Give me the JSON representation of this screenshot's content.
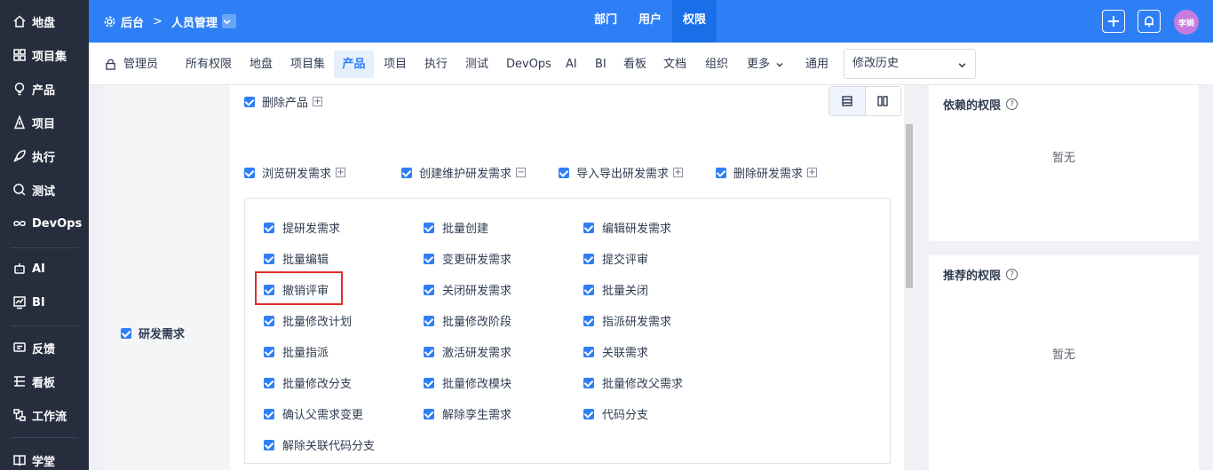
{
  "sidebar": {
    "items": [
      {
        "label": "地盘",
        "icon": "home-icon"
      },
      {
        "label": "项目集",
        "icon": "grid-icon"
      },
      {
        "label": "产品",
        "icon": "bulb-icon"
      },
      {
        "label": "项目",
        "icon": "project-icon"
      },
      {
        "label": "执行",
        "icon": "rocket-icon"
      },
      {
        "label": "测试",
        "icon": "search-icon"
      },
      {
        "label": "DevOps",
        "icon": "infinity-icon"
      },
      {
        "label": "AI",
        "icon": "robot-icon"
      },
      {
        "label": "BI",
        "icon": "chart-icon"
      },
      {
        "label": "反馈",
        "icon": "feedback-icon"
      },
      {
        "label": "看板",
        "icon": "kanban-icon"
      },
      {
        "label": "工作流",
        "icon": "workflow-icon"
      },
      {
        "label": "学堂",
        "icon": "school-icon"
      }
    ]
  },
  "header": {
    "crumb_root": "后台",
    "crumb_current": "人员管理",
    "nav": [
      "部门",
      "用户",
      "权限"
    ],
    "active_nav": "权限",
    "avatar_text": "李娟",
    "accent": "#2e7ff5"
  },
  "subnav": {
    "items": [
      "管理员",
      "所有权限",
      "地盘",
      "项目集",
      "产品",
      "项目",
      "执行",
      "测试",
      "DevOps",
      "AI",
      "BI",
      "看板",
      "文档",
      "组织",
      "更多",
      "通用"
    ],
    "active": "产品",
    "history_placeholder": "修改历史"
  },
  "permissions": {
    "left_group": "研发需求",
    "top_item": "删除产品",
    "row_items": [
      "浏览研发需求",
      "创建维护研发需求",
      "导入导出研发需求",
      "删除研发需求"
    ],
    "expanded_item": "创建维护研发需求",
    "sub_items": [
      "提研发需求",
      "批量创建",
      "编辑研发需求",
      "批量编辑",
      "变更研发需求",
      "提交评审",
      "撤销评审",
      "关闭研发需求",
      "批量关闭",
      "批量修改计划",
      "批量修改阶段",
      "指派研发需求",
      "批量指派",
      "激活研发需求",
      "关联需求",
      "批量修改分支",
      "批量修改模块",
      "批量修改父需求",
      "确认父需求变更",
      "解除孪生需求",
      "代码分支",
      "解除关联代码分支"
    ],
    "highlighted_item": "撤销评审"
  },
  "right_panels": {
    "depends_title": "依赖的权限",
    "depends_empty": "暂无",
    "recommend_title": "推荐的权限",
    "recommend_empty": "暂无"
  }
}
